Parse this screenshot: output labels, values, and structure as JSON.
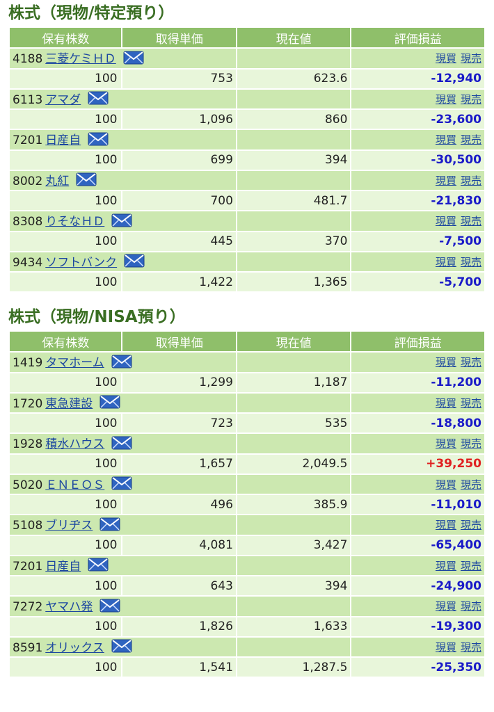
{
  "sections": [
    {
      "title": "株式（現物/特定預り）",
      "headers": [
        "保有株数",
        "取得単価",
        "現在値",
        "評価損益"
      ],
      "rows": [
        {
          "code": "4188",
          "name": "三菱ケミＨＤ",
          "qty": "100",
          "cost": "753",
          "price": "623.6",
          "pl": "-12,940",
          "pl_sign": "neg",
          "buy": "現買",
          "sell": "現売"
        },
        {
          "code": "6113",
          "name": "アマダ",
          "qty": "100",
          "cost": "1,096",
          "price": "860",
          "pl": "-23,600",
          "pl_sign": "neg",
          "buy": "現買",
          "sell": "現売"
        },
        {
          "code": "7201",
          "name": "日産自",
          "qty": "100",
          "cost": "699",
          "price": "394",
          "pl": "-30,500",
          "pl_sign": "neg",
          "buy": "現買",
          "sell": "現売"
        },
        {
          "code": "8002",
          "name": "丸紅",
          "qty": "100",
          "cost": "700",
          "price": "481.7",
          "pl": "-21,830",
          "pl_sign": "neg",
          "buy": "現買",
          "sell": "現売"
        },
        {
          "code": "8308",
          "name": "りそなＨＤ",
          "qty": "100",
          "cost": "445",
          "price": "370",
          "pl": "-7,500",
          "pl_sign": "neg",
          "buy": "現買",
          "sell": "現売"
        },
        {
          "code": "9434",
          "name": "ソフトバンク",
          "qty": "100",
          "cost": "1,422",
          "price": "1,365",
          "pl": "-5,700",
          "pl_sign": "neg",
          "buy": "現買",
          "sell": "現売"
        }
      ]
    },
    {
      "title": "株式（現物/NISA預り）",
      "headers": [
        "保有株数",
        "取得単価",
        "現在値",
        "評価損益"
      ],
      "rows": [
        {
          "code": "1419",
          "name": "タマホーム",
          "qty": "100",
          "cost": "1,299",
          "price": "1,187",
          "pl": "-11,200",
          "pl_sign": "neg",
          "buy": "現買",
          "sell": "現売"
        },
        {
          "code": "1720",
          "name": "東急建設",
          "qty": "100",
          "cost": "723",
          "price": "535",
          "pl": "-18,800",
          "pl_sign": "neg",
          "buy": "現買",
          "sell": "現売"
        },
        {
          "code": "1928",
          "name": "積水ハウス",
          "qty": "100",
          "cost": "1,657",
          "price": "2,049.5",
          "pl": "+39,250",
          "pl_sign": "pos",
          "buy": "現買",
          "sell": "現売"
        },
        {
          "code": "5020",
          "name": "ＥＮＥＯＳ",
          "qty": "100",
          "cost": "496",
          "price": "385.9",
          "pl": "-11,010",
          "pl_sign": "neg",
          "buy": "現買",
          "sell": "現売"
        },
        {
          "code": "5108",
          "name": "ブリヂス",
          "qty": "100",
          "cost": "4,081",
          "price": "3,427",
          "pl": "-65,400",
          "pl_sign": "neg",
          "buy": "現買",
          "sell": "現売"
        },
        {
          "code": "7201",
          "name": "日産自",
          "qty": "100",
          "cost": "643",
          "price": "394",
          "pl": "-24,900",
          "pl_sign": "neg",
          "buy": "現買",
          "sell": "現売"
        },
        {
          "code": "7272",
          "name": "ヤマハ発",
          "qty": "100",
          "cost": "1,826",
          "price": "1,633",
          "pl": "-19,300",
          "pl_sign": "neg",
          "buy": "現買",
          "sell": "現売"
        },
        {
          "code": "8591",
          "name": "オリックス",
          "qty": "100",
          "cost": "1,541",
          "price": "1,287.5",
          "pl": "-25,350",
          "pl_sign": "neg",
          "buy": "現買",
          "sell": "現売"
        }
      ]
    }
  ],
  "icons": {
    "mail": "mail-icon"
  },
  "colors": {
    "header_bg": "#8fbf6a",
    "name_row_bg": "#cce8b0",
    "value_row_bg": "#e8f6da",
    "negative": "#1a1ac8",
    "positive": "#e02020",
    "title": "#3a6e23"
  }
}
